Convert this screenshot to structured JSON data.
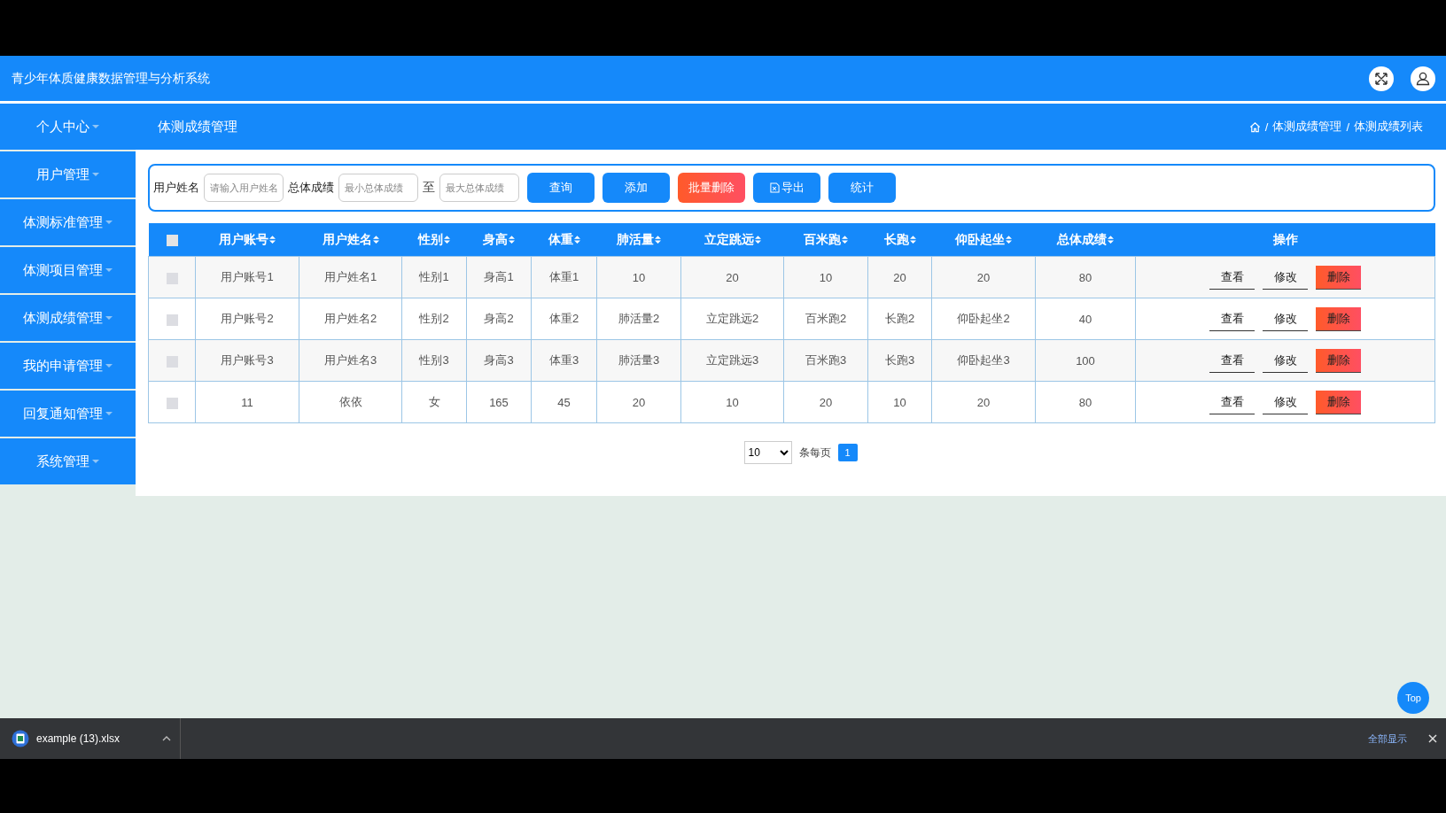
{
  "header": {
    "title": "青少年体质健康数据管理与分析系统"
  },
  "sidebar": {
    "items": [
      {
        "label": "个人中心"
      },
      {
        "label": "用户管理"
      },
      {
        "label": "体测标准管理"
      },
      {
        "label": "体测项目管理"
      },
      {
        "label": "体测成绩管理"
      },
      {
        "label": "我的申请管理"
      },
      {
        "label": "回复通知管理"
      },
      {
        "label": "系统管理"
      }
    ]
  },
  "page_title": "体测成绩管理",
  "breadcrumb": {
    "separator": "/",
    "items": [
      "体测成绩管理",
      "体测成绩列表"
    ]
  },
  "search": {
    "name_label": "用户姓名",
    "name_placeholder": "请输入用户姓名",
    "score_label": "总体成绩",
    "min_placeholder": "最小总体成绩",
    "range_word": "至",
    "max_placeholder": "最大总体成绩",
    "buttons": [
      {
        "label": "查询",
        "kind": "primary"
      },
      {
        "label": "添加",
        "kind": "primary"
      },
      {
        "label": "批量删除",
        "kind": "danger"
      },
      {
        "label": "导出",
        "kind": "export"
      },
      {
        "label": "统计",
        "kind": "primary"
      }
    ]
  },
  "table": {
    "select_all": {
      "checked": false
    },
    "columns": [
      {
        "label": "用户账号",
        "sortable": true
      },
      {
        "label": "用户姓名",
        "sortable": true
      },
      {
        "label": "性别",
        "sortable": true
      },
      {
        "label": "身高",
        "sortable": true
      },
      {
        "label": "体重",
        "sortable": true
      },
      {
        "label": "肺活量",
        "sortable": true
      },
      {
        "label": "立定跳远",
        "sortable": true
      },
      {
        "label": "百米跑",
        "sortable": true
      },
      {
        "label": "长跑",
        "sortable": true
      },
      {
        "label": "仰卧起坐",
        "sortable": true
      },
      {
        "label": "总体成绩",
        "sortable": true
      },
      {
        "label": "操作",
        "sortable": false
      }
    ],
    "rows": [
      {
        "selected": false,
        "cells": [
          "用户账号1",
          "用户姓名1",
          "性别1",
          "身高1",
          "体重1",
          "10",
          "20",
          "10",
          "20",
          "20",
          "80"
        ],
        "actions": [
          {
            "label": "查看",
            "kind": "link"
          },
          {
            "label": "修改",
            "kind": "link"
          },
          {
            "label": "删除",
            "kind": "danger"
          }
        ]
      },
      {
        "selected": false,
        "cells": [
          "用户账号2",
          "用户姓名2",
          "性别2",
          "身高2",
          "体重2",
          "肺活量2",
          "立定跳远2",
          "百米跑2",
          "长跑2",
          "仰卧起坐2",
          "40"
        ],
        "actions": [
          {
            "label": "查看",
            "kind": "link"
          },
          {
            "label": "修改",
            "kind": "link"
          },
          {
            "label": "删除",
            "kind": "danger"
          }
        ]
      },
      {
        "selected": false,
        "cells": [
          "用户账号3",
          "用户姓名3",
          "性别3",
          "身高3",
          "体重3",
          "肺活量3",
          "立定跳远3",
          "百米跑3",
          "长跑3",
          "仰卧起坐3",
          "100"
        ],
        "actions": [
          {
            "label": "查看",
            "kind": "link"
          },
          {
            "label": "修改",
            "kind": "link"
          },
          {
            "label": "删除",
            "kind": "danger"
          }
        ]
      },
      {
        "selected": false,
        "cells": [
          "11",
          "依依",
          "女",
          "165",
          "45",
          "20",
          "10",
          "20",
          "10",
          "20",
          "80"
        ],
        "actions": [
          {
            "label": "查看",
            "kind": "link"
          },
          {
            "label": "修改",
            "kind": "link"
          },
          {
            "label": "删除",
            "kind": "danger"
          }
        ]
      }
    ]
  },
  "pagination": {
    "page_size": "10",
    "page_size_label": "条每页",
    "pages": [
      {
        "label": "1",
        "selected": true
      }
    ]
  },
  "top_button": {
    "label": "Top"
  },
  "download_bar": {
    "file_name": "example (13).xlsx",
    "show_all": "全部显示"
  }
}
